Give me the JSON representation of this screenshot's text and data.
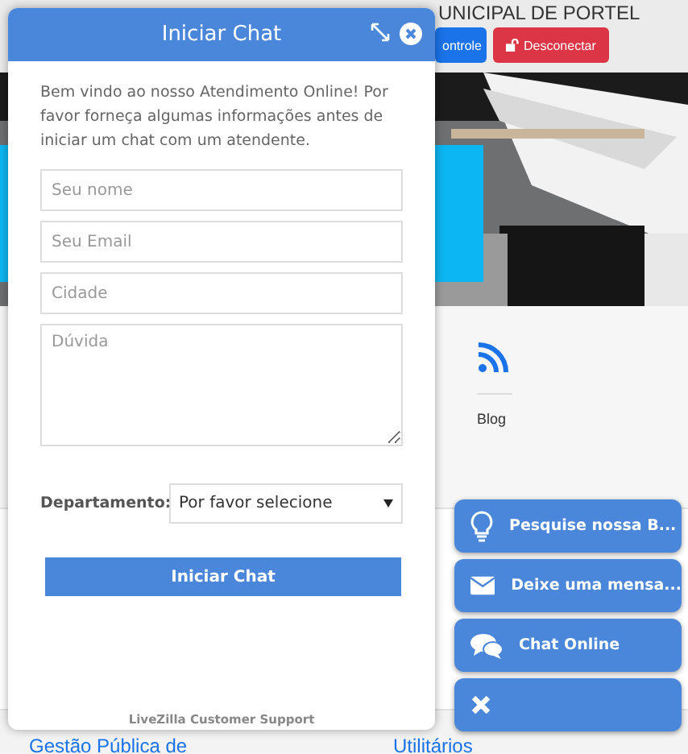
{
  "page": {
    "header_title": "UNICIPAL DE PORTEL",
    "header_buttons": [
      {
        "label": "ontrole",
        "kind": "primary"
      },
      {
        "label": "Desconectar",
        "kind": "danger"
      }
    ],
    "blog_label": "Blog",
    "bottom_links": [
      "Gestão Pública de",
      "Utilitários"
    ]
  },
  "chat": {
    "title": "Iniciar Chat",
    "intro": "Bem vindo ao nosso Atendimento Online! Por favor forneça algumas informações antes de iniciar um chat com um atendente.",
    "fields": [
      {
        "placeholder": "Seu nome",
        "kind": "input"
      },
      {
        "placeholder": "Seu Email",
        "kind": "input"
      },
      {
        "placeholder": "Cidade",
        "kind": "input"
      },
      {
        "placeholder": "Dúvida",
        "kind": "textarea"
      }
    ],
    "department_label": "Departamento:",
    "department_value": "Por favor selecione",
    "submit": "Iniciar Chat",
    "footer": "LiveZilla Customer Support"
  },
  "float_buttons": [
    {
      "label": "Pesquise nossa B...",
      "kind": "bulb"
    },
    {
      "label": "Deixe uma mensa...",
      "kind": "mail"
    },
    {
      "label": "Chat Online",
      "kind": "chat"
    },
    {
      "kind": "close"
    }
  ]
}
